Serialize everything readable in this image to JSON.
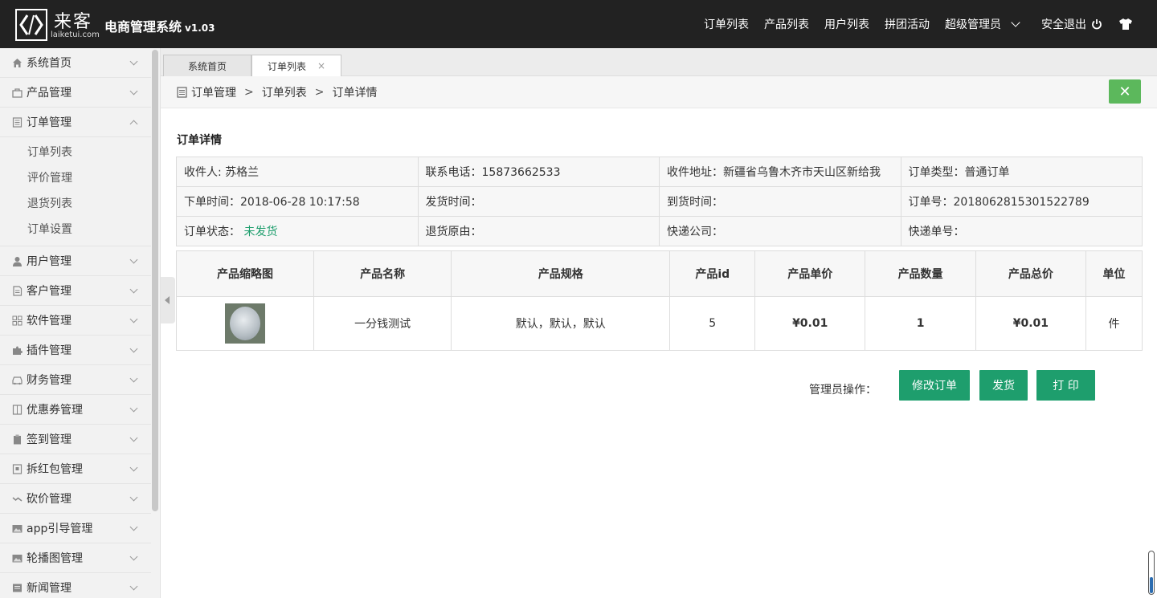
{
  "header": {
    "logo_cn": "来客",
    "logo_en": "laiketui.com",
    "title": "电商管理系统",
    "version": "v1.03",
    "nav": [
      "订单列表",
      "产品列表",
      "用户列表",
      "拼团活动"
    ],
    "admin": "超级管理员",
    "logout": "安全退出"
  },
  "sidebar": {
    "items_top": [
      {
        "label": "系统首页",
        "icon": "home-icon"
      },
      {
        "label": "产品管理",
        "icon": "bag-icon"
      },
      {
        "label": "订单管理",
        "icon": "document-icon"
      }
    ],
    "sub_items": [
      "订单列表",
      "评价管理",
      "退货列表",
      "订单设置"
    ],
    "items_bottom": [
      {
        "label": "用户管理",
        "icon": "user-icon"
      },
      {
        "label": "客户管理",
        "icon": "file-icon"
      },
      {
        "label": "软件管理",
        "icon": "grid-icon"
      },
      {
        "label": "插件管理",
        "icon": "puzzle-icon"
      },
      {
        "label": "财务管理",
        "icon": "car-icon"
      },
      {
        "label": "优惠券管理",
        "icon": "book-icon"
      },
      {
        "label": "签到管理",
        "icon": "clipboard-icon"
      },
      {
        "label": "拆红包管理",
        "icon": "envelope-icon"
      },
      {
        "label": "砍价管理",
        "icon": "trend-icon"
      },
      {
        "label": "app引导管理",
        "icon": "image-icon"
      },
      {
        "label": "轮播图管理",
        "icon": "image-icon"
      },
      {
        "label": "新闻管理",
        "icon": "news-icon"
      }
    ]
  },
  "tabs": [
    {
      "label": "系统首页"
    },
    {
      "label": "订单列表",
      "close": "×"
    }
  ],
  "breadcrumb": {
    "items": [
      "订单管理",
      "订单列表",
      "订单详情"
    ],
    "separator": ">",
    "close_label": "✕"
  },
  "detail": {
    "title": "订单详情",
    "rows": [
      [
        {
          "label": "收件人: ",
          "value": "苏格兰"
        },
        {
          "label": "联系电话：",
          "value": "15873662533"
        },
        {
          "label": "收件地址：",
          "value": "新疆省乌鲁木齐市天山区新给我"
        },
        {
          "label": "订单类型：",
          "value": "普通订单"
        }
      ],
      [
        {
          "label": "下单时间：",
          "value": "2018-06-28 10:17:58"
        },
        {
          "label": "发货时间：",
          "value": ""
        },
        {
          "label": "到货时间：",
          "value": ""
        },
        {
          "label": "订单号：",
          "value": "2018062815301522789"
        }
      ],
      [
        {
          "label": "订单状态： ",
          "value": "未发货"
        },
        {
          "label": "退货原由：",
          "value": ""
        },
        {
          "label": "快递公司：",
          "value": ""
        },
        {
          "label": "快递单号：",
          "value": ""
        }
      ]
    ]
  },
  "products": {
    "headers": [
      "产品缩略图",
      "产品名称",
      "产品规格",
      "产品id",
      "产品单价",
      "产品数量",
      "产品总价",
      "单位"
    ],
    "rows": [
      {
        "name": "一分钱测试",
        "spec": "默认，默认，默认",
        "id": "5",
        "price": "¥0.01",
        "qty": "1",
        "total": "¥0.01",
        "unit": "件"
      }
    ]
  },
  "actions": {
    "label": "管理员操作：",
    "edit": "修改订单",
    "ship": "发货",
    "print": "打 印"
  },
  "colors": {
    "accent": "#1e9e6d",
    "close_green": "#5cb85c",
    "header_bg": "#222222"
  }
}
